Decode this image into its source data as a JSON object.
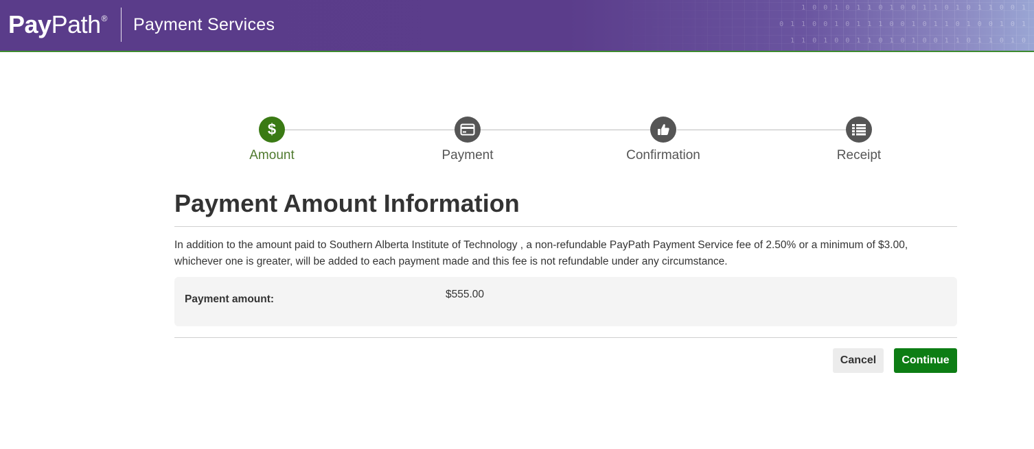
{
  "header": {
    "logo_pay": "Pay",
    "logo_path": "Path",
    "logo_reg": "®",
    "subtitle": "Payment Services"
  },
  "stepper": {
    "steps": [
      {
        "label": "Amount",
        "icon": "dollar-icon",
        "active": true
      },
      {
        "label": "Payment",
        "icon": "credit-card-icon",
        "active": false
      },
      {
        "label": "Confirmation",
        "icon": "thumbs-up-icon",
        "active": false
      },
      {
        "label": "Receipt",
        "icon": "list-icon",
        "active": false
      }
    ]
  },
  "main": {
    "title": "Payment Amount Information",
    "info": "In addition to the amount paid to Southern Alberta Institute of Technology , a non-refundable PayPath Payment Service fee of 2.50% or a minimum of $3.00, whichever one is greater, will be added to each payment made and this fee is not refundable under any circumstance.",
    "amount_label": "Payment amount:",
    "amount_value": "$555.00"
  },
  "actions": {
    "cancel_label": "Cancel",
    "continue_label": "Continue"
  },
  "colors": {
    "header_purple": "#5a3c8a",
    "active_green": "#3a7a14",
    "continue_green": "#0d7d14",
    "inactive_step": "#555555"
  }
}
